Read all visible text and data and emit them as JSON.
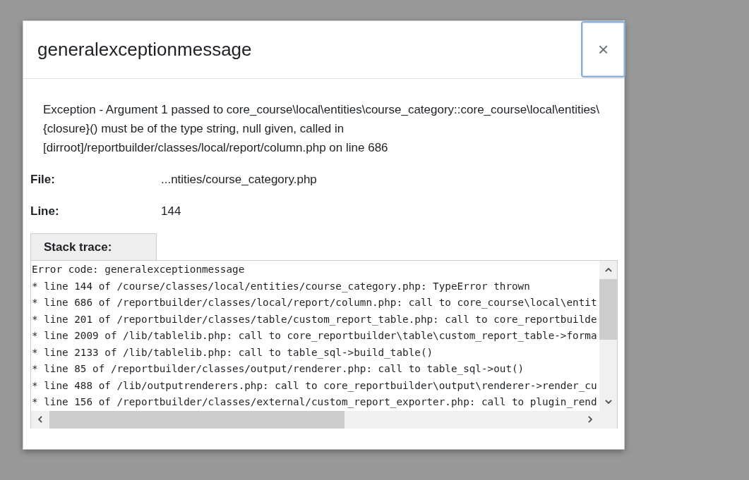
{
  "dialog": {
    "title": "generalexceptionmessage",
    "close_button": {
      "label": "×",
      "focused": true
    },
    "message": "Exception - Argument 1 passed to core_course\\local\\entities\\course_category::core_course\\local\\entities\\{closure}() must be of the type string, null given, called in [dirroot]/reportbuilder/classes/local/report/column.php on line 686",
    "details": [
      {
        "label": "File:",
        "value": "...ntities/course_category.php"
      },
      {
        "label": "Line:",
        "value": "144"
      }
    ],
    "stack_trace": {
      "heading": "Stack trace:",
      "lines": [
        "Error code: generalexceptionmessage",
        "* line 144 of /course/classes/local/entities/course_category.php: TypeError thrown",
        "* line 686 of /reportbuilder/classes/local/report/column.php: call to core_course\\local\\entit",
        "* line 201 of /reportbuilder/classes/table/custom_report_table.php: call to core_reportbuilde",
        "* line 2009 of /lib/tablelib.php: call to core_reportbuilder\\table\\custom_report_table->forma",
        "* line 2133 of /lib/tablelib.php: call to table_sql->build_table()",
        "* line 85 of /reportbuilder/classes/output/renderer.php: call to table_sql->out()",
        "* line 488 of /lib/outputrenderers.php: call to core_reportbuilder\\output\\renderer->render_cu",
        "* line 156 of /reportbuilder/classes/external/custom_report_exporter.php: call to plugin_rend"
      ]
    }
  }
}
